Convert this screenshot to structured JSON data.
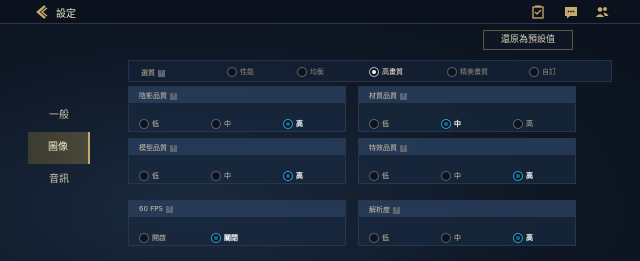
{
  "header": {
    "title": "設定",
    "icons": [
      "back-arrow-icon",
      "mission-icon",
      "chat-icon",
      "friends-icon"
    ]
  },
  "reset_button": "還原為預設值",
  "sidebar": {
    "items": [
      {
        "label": "一般",
        "active": false
      },
      {
        "label": "圖像",
        "active": true
      },
      {
        "label": "音訊",
        "active": false
      }
    ]
  },
  "preset": {
    "label": "選質",
    "info": "?",
    "options": [
      {
        "label": "性能",
        "selected": false
      },
      {
        "label": "均衡",
        "selected": false
      },
      {
        "label": "高畫質",
        "selected": true
      },
      {
        "label": "精美畫質",
        "selected": false
      },
      {
        "label": "自訂",
        "selected": false
      }
    ]
  },
  "panels": [
    {
      "title": "陰影品質",
      "options": [
        "低",
        "中",
        "高"
      ],
      "selected": 2
    },
    {
      "title": "材質品質",
      "options": [
        "低",
        "中",
        "高"
      ],
      "selected": 1
    },
    {
      "title": "模型品質",
      "options": [
        "低",
        "中",
        "高"
      ],
      "selected": 2
    },
    {
      "title": "特效品質",
      "options": [
        "低",
        "中",
        "高"
      ],
      "selected": 2
    },
    {
      "title": "60 FPS",
      "options": [
        "開啟",
        "關閉"
      ],
      "selected": 1
    },
    {
      "title": "解析度",
      "options": [
        "低",
        "中",
        "高"
      ],
      "selected": 2
    }
  ],
  "colors": {
    "accent_gold": "#c8aa6e",
    "radio_blue": "#2aa4d6",
    "background": "#0e1725"
  }
}
